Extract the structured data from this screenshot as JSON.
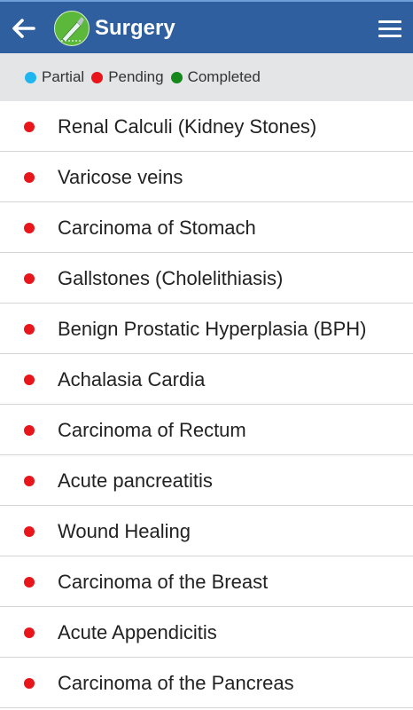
{
  "header": {
    "title": "Surgery",
    "back_icon": "arrow-left-icon",
    "logo_icon": "scalpel-icon",
    "menu_icon": "hamburger-menu-icon",
    "bar_color": "#2f5f9e"
  },
  "legend": {
    "items": [
      {
        "label": "Partial",
        "color": "#1fb6f0"
      },
      {
        "label": "Pending",
        "color": "#e8151a"
      },
      {
        "label": "Completed",
        "color": "#14881a"
      }
    ]
  },
  "topics": [
    {
      "label": "Renal Calculi (Kidney Stones)",
      "status": "Pending"
    },
    {
      "label": "Varicose veins",
      "status": "Pending"
    },
    {
      "label": "Carcinoma of Stomach",
      "status": "Pending"
    },
    {
      "label": "Gallstones (Cholelithiasis)",
      "status": "Pending"
    },
    {
      "label": "Benign Prostatic Hyperplasia (BPH)",
      "status": "Pending"
    },
    {
      "label": "Achalasia Cardia",
      "status": "Pending"
    },
    {
      "label": "Carcinoma of Rectum",
      "status": "Pending"
    },
    {
      "label": "Acute pancreatitis",
      "status": "Pending"
    },
    {
      "label": "Wound Healing",
      "status": "Pending"
    },
    {
      "label": "Carcinoma of the Breast",
      "status": "Pending"
    },
    {
      "label": "Acute Appendicitis",
      "status": "Pending"
    },
    {
      "label": "Carcinoma of the Pancreas",
      "status": "Pending"
    }
  ]
}
